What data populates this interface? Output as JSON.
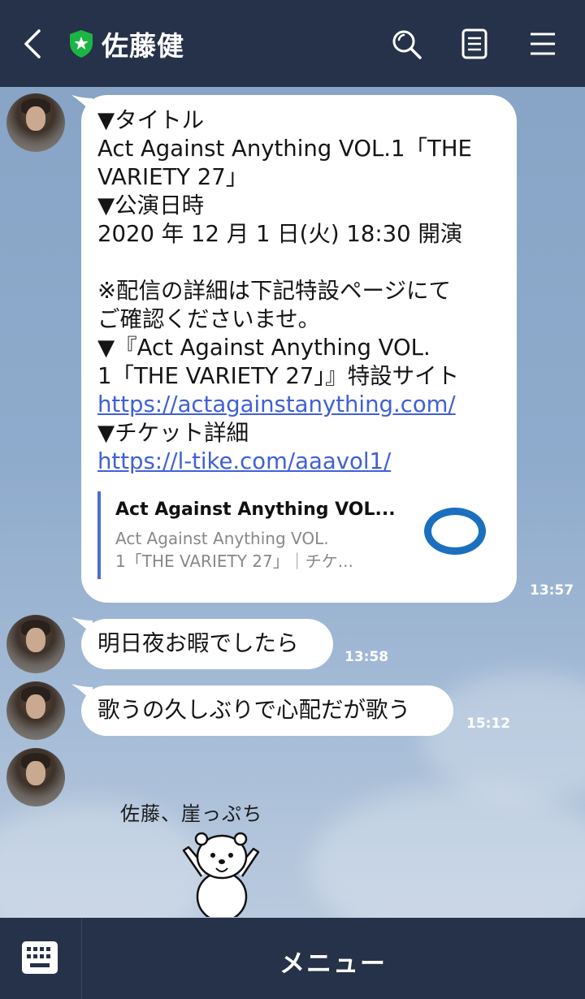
{
  "header": {
    "title": "佐藤健",
    "back_icon": "chevron-left-icon",
    "badge_icon": "verified-shield-icon",
    "badge_color": "#1db446",
    "actions": [
      "search-icon",
      "notes-icon",
      "menu-icon"
    ]
  },
  "messages": [
    {
      "lines": [
        "▼タイトル",
        "Act Against Anything VOL.1「THE",
        "VARIETY 27」",
        "▼公演日時",
        "2020 年 12 月 1 日(火) 18:30 開演",
        "",
        "※配信の詳細は下記特設ページにて",
        "ご確認くださいませ。",
        "▼『Act Against Anything VOL.",
        "1「THE VARIETY 27」』特設サイト"
      ],
      "link1": "https://actagainstanything.com/",
      "after_link1": "▼チケット詳細",
      "link2": "https://l-tike.com/aaavol1/",
      "preview": {
        "title": "Act Against Anything VOL...",
        "description": "Act Against Anything VOL.\n1「THE VARIETY 27」｜チケ...",
        "logo_icon": "lawson-ticket-logo-icon",
        "logo_color": "#1a6fbf"
      },
      "time": "13:57"
    },
    {
      "text": "明日夜お暇でしたら",
      "time": "13:58"
    },
    {
      "text": "歌うの久しぶりで心配だが歌う",
      "time": "15:12"
    },
    {
      "sticker_text": "佐藤、崖っぷち",
      "sticker_icon": "polar-bear-sticker-icon"
    }
  ],
  "footer": {
    "keyboard_icon": "keyboard-icon",
    "menu_label": "メニュー"
  }
}
